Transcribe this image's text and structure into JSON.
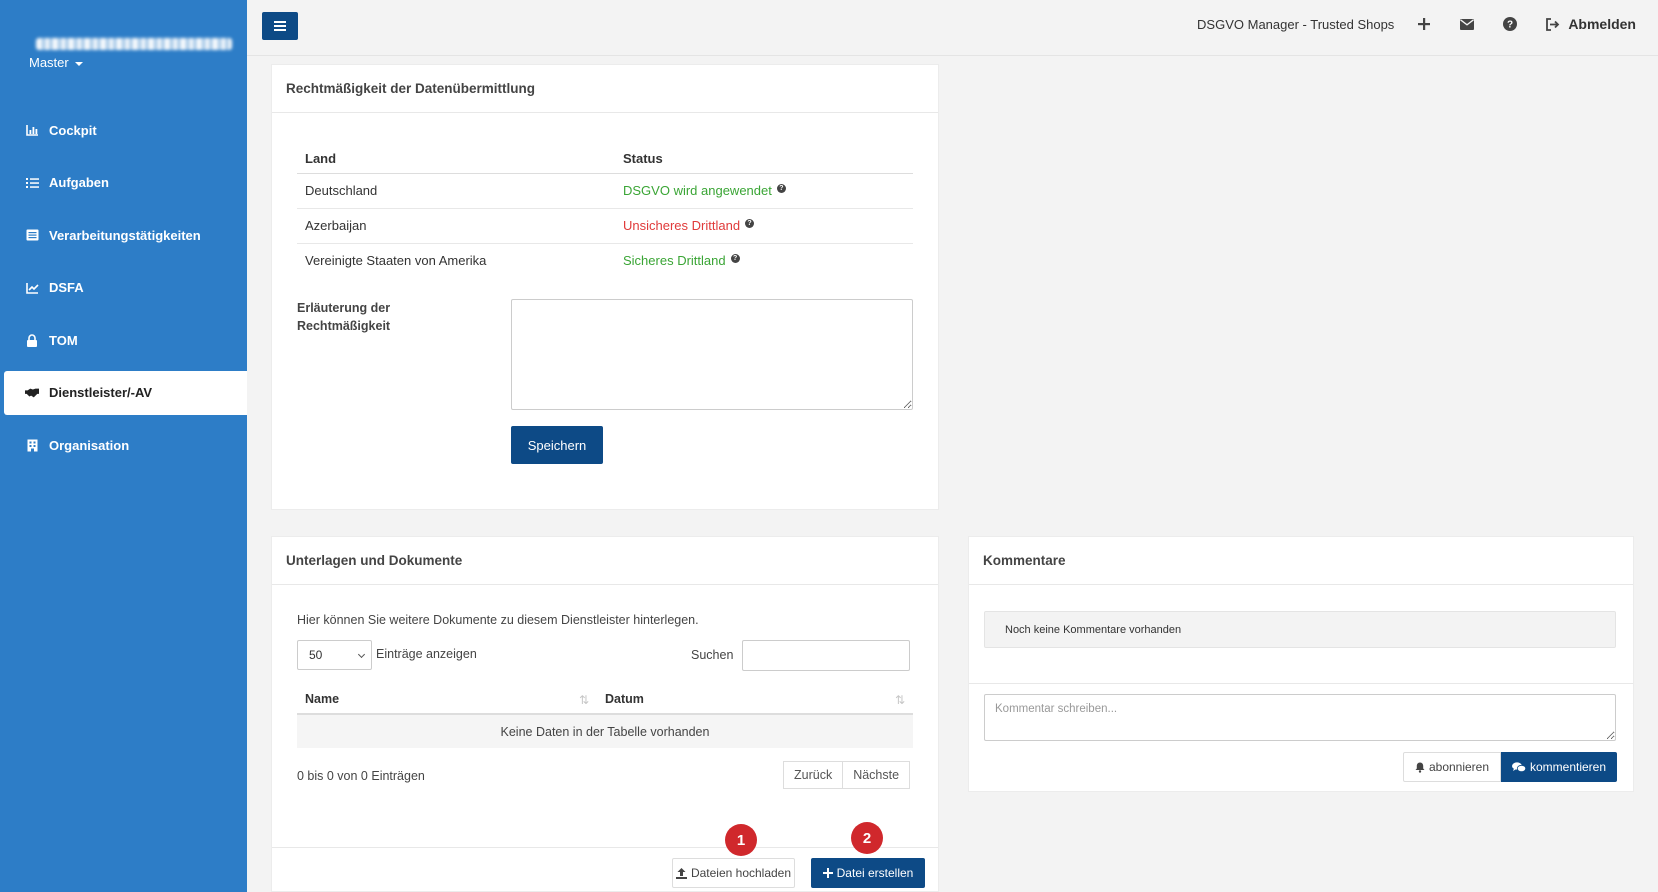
{
  "sidebar": {
    "account": "Master",
    "items": [
      {
        "label": "Cockpit",
        "icon": "chart-bar-icon"
      },
      {
        "label": "Aufgaben",
        "icon": "task-list-icon"
      },
      {
        "label": "Verarbeitungstätigkeiten",
        "icon": "list-alt-icon"
      },
      {
        "label": "DSFA",
        "icon": "chart-line-icon"
      },
      {
        "label": "TOM",
        "icon": "lock-icon"
      },
      {
        "label": "Dienstleister/-AV",
        "icon": "handshake-icon",
        "active": true
      },
      {
        "label": "Organisation",
        "icon": "building-icon"
      }
    ]
  },
  "topbar": {
    "title": "DSGVO Manager - Trusted Shops",
    "logout": "Abmelden"
  },
  "legality": {
    "heading": "Rechtmäßigkeit der Datenübermittlung",
    "columns": [
      "Land",
      "Status"
    ],
    "rows": [
      {
        "country": "Deutschland",
        "status": "DSGVO wird angewendet",
        "status_color": "#3aa535"
      },
      {
        "country": "Azerbaijan",
        "status": "Unsicheres Drittland",
        "status_color": "#e03a3a"
      },
      {
        "country": "Vereinigte Staaten von Amerika",
        "status": "Sicheres Drittland",
        "status_color": "#3aa535"
      }
    ],
    "explanation_label": "Erläuterung der Rechtmäßigkeit",
    "explanation_value": "",
    "save_label": "Speichern"
  },
  "documents": {
    "heading": "Unterlagen und Dokumente",
    "description": "Hier können Sie weitere Dokumente zu diesem Dienstleister hinterlegen.",
    "page_size": "50",
    "entries_label": "Einträge anzeigen",
    "search_label": "Suchen",
    "search_value": "",
    "columns": [
      "Name",
      "Datum"
    ],
    "empty_text": "Keine Daten in der Tabelle vorhanden",
    "info": "0 bis 0 von 0 Einträgen",
    "prev_label": "Zurück",
    "next_label": "Nächste",
    "upload_label": "Dateien hochladen",
    "create_label": "Datei erstellen",
    "badges": [
      "1",
      "2"
    ]
  },
  "comments": {
    "heading": "Kommentare",
    "empty_text": "Noch keine Kommentare vorhanden",
    "placeholder": "Kommentar schreiben...",
    "subscribe_label": "abonnieren",
    "comment_label": "kommentieren"
  },
  "colors": {
    "sidebar": "#2d7dc7",
    "primary": "#0d4a86",
    "ok": "#3aa535",
    "danger": "#e03a3a",
    "badge": "#d0282c"
  }
}
